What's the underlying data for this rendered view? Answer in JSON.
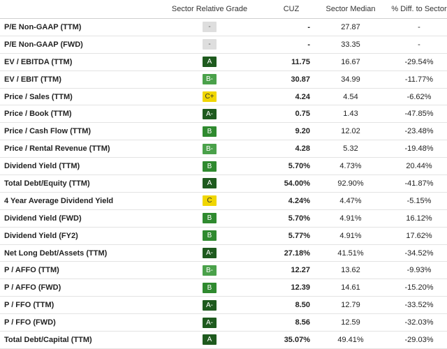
{
  "headers": {
    "metric": "",
    "grade": "Sector Relative Grade",
    "cuz": "CUZ",
    "median": "Sector Median",
    "diff": "% Diff. to Sector"
  },
  "grade_colors": {
    "A": "#1e5a1e",
    "A-": "#1e5a1e",
    "B": "#2f8a2f",
    "B-": "#4aa14a",
    "C+": "#f0d600",
    "C": "#f0d600",
    "-": "#dedede"
  },
  "rows": [
    {
      "metric": "P/E Non-GAAP (TTM)",
      "grade": "-",
      "cuz": "-",
      "median": "27.87",
      "diff": "-"
    },
    {
      "metric": "P/E Non-GAAP (FWD)",
      "grade": "-",
      "cuz": "-",
      "median": "33.35",
      "diff": "-"
    },
    {
      "metric": "EV / EBITDA (TTM)",
      "grade": "A",
      "cuz": "11.75",
      "median": "16.67",
      "diff": "-29.54%"
    },
    {
      "metric": "EV / EBIT (TTM)",
      "grade": "B-",
      "cuz": "30.87",
      "median": "34.99",
      "diff": "-11.77%"
    },
    {
      "metric": "Price / Sales (TTM)",
      "grade": "C+",
      "cuz": "4.24",
      "median": "4.54",
      "diff": "-6.62%"
    },
    {
      "metric": "Price / Book (TTM)",
      "grade": "A-",
      "cuz": "0.75",
      "median": "1.43",
      "diff": "-47.85%"
    },
    {
      "metric": "Price / Cash Flow (TTM)",
      "grade": "B",
      "cuz": "9.20",
      "median": "12.02",
      "diff": "-23.48%"
    },
    {
      "metric": "Price / Rental Revenue (TTM)",
      "grade": "B-",
      "cuz": "4.28",
      "median": "5.32",
      "diff": "-19.48%"
    },
    {
      "metric": "Dividend Yield (TTM)",
      "grade": "B",
      "cuz": "5.70%",
      "median": "4.73%",
      "diff": "20.44%"
    },
    {
      "metric": "Total Debt/Equity (TTM)",
      "grade": "A",
      "cuz": "54.00%",
      "median": "92.90%",
      "diff": "-41.87%"
    },
    {
      "metric": "4 Year Average Dividend Yield",
      "grade": "C",
      "cuz": "4.24%",
      "median": "4.47%",
      "diff": "-5.15%"
    },
    {
      "metric": "Dividend Yield (FWD)",
      "grade": "B",
      "cuz": "5.70%",
      "median": "4.91%",
      "diff": "16.12%"
    },
    {
      "metric": "Dividend Yield (FY2)",
      "grade": "B",
      "cuz": "5.77%",
      "median": "4.91%",
      "diff": "17.62%"
    },
    {
      "metric": "Net Long Debt/Assets (TTM)",
      "grade": "A-",
      "cuz": "27.18%",
      "median": "41.51%",
      "diff": "-34.52%"
    },
    {
      "metric": "P / AFFO (TTM)",
      "grade": "B-",
      "cuz": "12.27",
      "median": "13.62",
      "diff": "-9.93%"
    },
    {
      "metric": "P / AFFO (FWD)",
      "grade": "B",
      "cuz": "12.39",
      "median": "14.61",
      "diff": "-15.20%"
    },
    {
      "metric": "P / FFO (TTM)",
      "grade": "A-",
      "cuz": "8.50",
      "median": "12.79",
      "diff": "-33.52%"
    },
    {
      "metric": "P / FFO (FWD)",
      "grade": "A-",
      "cuz": "8.56",
      "median": "12.59",
      "diff": "-32.03%"
    },
    {
      "metric": "Total Debt/Capital (TTM)",
      "grade": "A",
      "cuz": "35.07%",
      "median": "49.41%",
      "diff": "-29.03%"
    }
  ]
}
